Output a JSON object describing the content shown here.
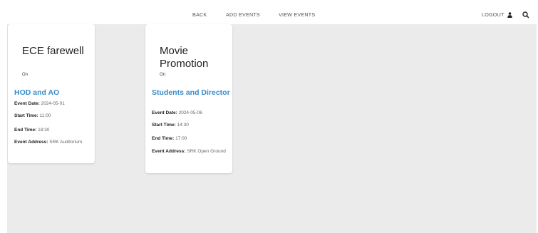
{
  "nav": {
    "back": "BACK",
    "add_events": "ADD EVENTS",
    "view_events": "VIEW EVENTS",
    "logout": "LOGOUT",
    "user_icon": "user-icon",
    "search_icon": "search-icon"
  },
  "labels": {
    "event_date": "Event Date:",
    "start_time": "Start Time:",
    "end_time": "End Time:",
    "event_address": "Event Address:"
  },
  "events": [
    {
      "title": "ECE farewell",
      "status": "On",
      "host": "HOD and AO",
      "event_date": "2024-05-01",
      "start_time": "11:00",
      "end_time": "18:30",
      "event_address": "SRK Auditorium"
    },
    {
      "title": "Movie Promotion",
      "status": "On",
      "host": "Students and Director",
      "event_date": "2024-05-06",
      "start_time": "14:30",
      "end_time": "17:00",
      "event_address": "SRK Open Ground"
    }
  ],
  "colors": {
    "background": "#ebebeb",
    "accent": "#3a8cc9",
    "card": "#ffffff"
  }
}
